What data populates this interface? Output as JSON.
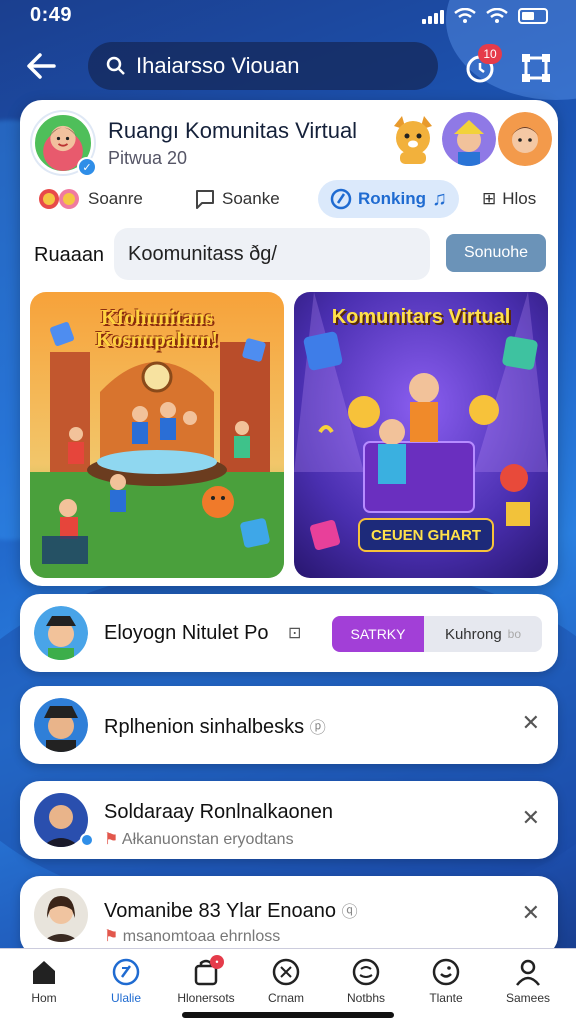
{
  "status": {
    "time": "0:49"
  },
  "header": {
    "search_text": "Ihaiarsso Viouan",
    "notification_count": "10"
  },
  "community": {
    "title": "Ruangı Komunitas Virtual",
    "subtitle": "Pitwua 20",
    "tabs": [
      {
        "label": "Soanre",
        "icon": "emoji-icon"
      },
      {
        "label": "Soanke",
        "icon": "chat-icon"
      },
      {
        "label": "Ronking",
        "icon": "music-icon",
        "active": true
      },
      {
        "label": "Hlos",
        "icon": "link-icon"
      }
    ],
    "input_label": "Ruaaan",
    "input_value": "Koomunitass ðg/",
    "search_button": "Sonuohe"
  },
  "images": [
    {
      "title": "Kfohunitans Kosnupahun!",
      "caption": "",
      "badge": ""
    },
    {
      "title": "Komunitars Virtual",
      "caption": "",
      "badge": "CEUEN GHART"
    }
  ],
  "list": [
    {
      "name": "Eloyogn Nitulet Po",
      "btn1": "SATRKY",
      "btn2": "Kuhrong",
      "btn2_extra": "bo"
    },
    {
      "name": "Rplhenion sinhalbesks",
      "sub": ""
    },
    {
      "name": "Soldaraay Ronlnalkaonen",
      "sub": "Ałkanuonstan eryodtans"
    },
    {
      "name": "Vomanibe 83 Ylar Enoano",
      "sub": "msanomtoaa ehrnloss"
    }
  ],
  "nav": [
    {
      "label": "Hom",
      "icon": "home-icon"
    },
    {
      "label": "Ulalie",
      "icon": "play-icon",
      "active": true
    },
    {
      "label": "Hlonersots",
      "icon": "bag-icon"
    },
    {
      "label": "Crnam",
      "icon": "clock-icon"
    },
    {
      "label": "Notbhs",
      "icon": "globe-icon"
    },
    {
      "label": "Tlante",
      "icon": "smile-icon"
    },
    {
      "label": "Samees",
      "icon": "person-icon"
    }
  ]
}
